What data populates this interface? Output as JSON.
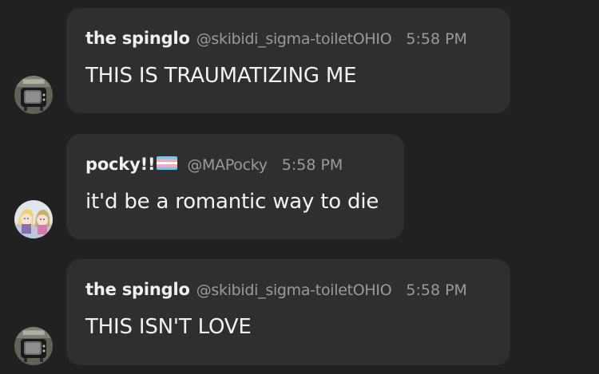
{
  "colors": {
    "background": "#212121",
    "bubble": "#2f2f2f",
    "name": "#f0f0f0",
    "meta": "#9a9a9a",
    "flag": [
      "#5bcefa",
      "#f5a9b8",
      "#ffffff",
      "#f5a9b8",
      "#5bcefa"
    ]
  },
  "messages": [
    {
      "author": "the spinglo",
      "handle": "@skibidi_sigma-toiletOHIO",
      "time": "5:58 PM",
      "text": "THIS IS TRAUMATIZING ME",
      "avatar_icon": "tv-avatar-icon"
    },
    {
      "author": "pocky!!",
      "author_flag": "transgender-flag-icon",
      "handle": "@MAPocky",
      "time": "5:58 PM",
      "text": "it'd be a romantic way to die",
      "avatar_icon": "anime-girls-avatar-icon"
    },
    {
      "author": "the spinglo",
      "handle": "@skibidi_sigma-toiletOHIO",
      "time": "5:58 PM",
      "text": "THIS ISN'T LOVE",
      "avatar_icon": "tv-avatar-icon"
    }
  ]
}
